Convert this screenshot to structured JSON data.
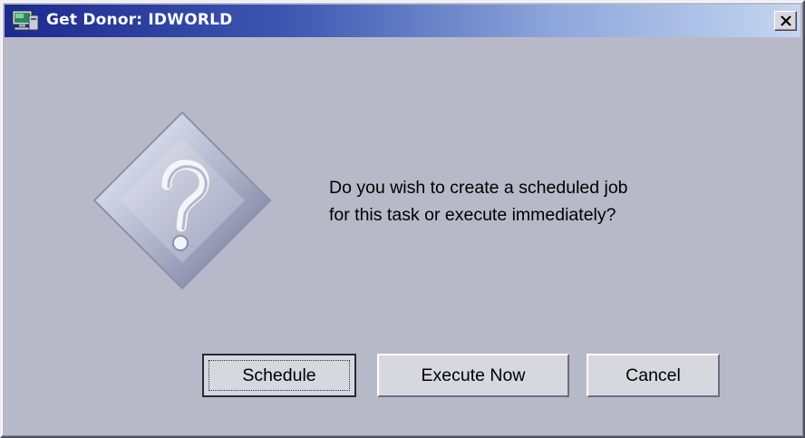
{
  "window": {
    "title": "Get Donor: IDWORLD",
    "close_glyph": "✕",
    "app_icon": "computer-monitor-icon"
  },
  "dialog": {
    "icon": "question-mark-icon",
    "message_line1": "Do you wish to create a scheduled job",
    "message_line2": "for this task or execute immediately?"
  },
  "buttons": {
    "schedule_label": "Schedule",
    "execute_now_label": "Execute Now",
    "cancel_label": "Cancel"
  },
  "colors": {
    "title_gradient_start": "#1c2a8e",
    "title_gradient_end": "#c6d6f0",
    "dialog_background": "#b8b9c8"
  }
}
